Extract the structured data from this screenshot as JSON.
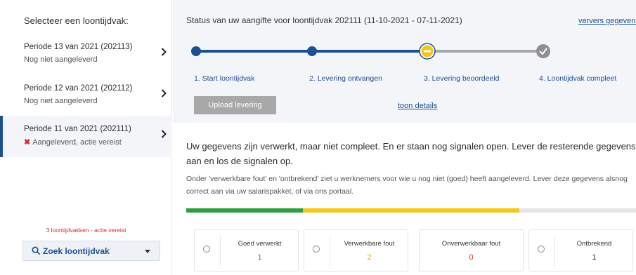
{
  "sidebar": {
    "title": "Selecteer een loontijdvak:",
    "periods": [
      {
        "title": "Periode 13 van 2021 (202113)",
        "status": "Nog niet aangeleverd"
      },
      {
        "title": "Periode 12 van 2021 (202112)",
        "status": "Nog niet aangeleverd"
      },
      {
        "title": "Periode 11 van 2021 (202111)",
        "status": "Aangeleverd, actie vereist",
        "selected": true
      }
    ],
    "warning": "3 loontijdvakken - actie vereist",
    "search_label": "Zoek loontijdvak"
  },
  "main": {
    "status_title": "Status van uw aangifte voor loontijdvak 202111 (11-10-2021 - 07-11-2021)",
    "refresh_link": "ververs gegevens",
    "steps": [
      {
        "label": "1. Start loontijdvak",
        "state": "done"
      },
      {
        "label": "2. Levering ontvangen",
        "state": "done"
      },
      {
        "label": "3. Levering beoordeeld",
        "state": "warning"
      },
      {
        "label": "4. Loontijdvak compleet",
        "state": "pending"
      }
    ],
    "upload_button": "Upload levering",
    "details_link": "toon details",
    "message": "Uw gegevens zijn verwerkt, maar niet compleet. En er staan nog signalen open. Lever de resterende gegevens aan en los de signalen op.",
    "submessage": "Onder 'verwerkbare fout' en 'ontbrekend' ziet u werknemers voor wie u nog niet (goed) heeft aangeleverd. Lever deze gegevens alsnog correct aan via uw salarispakket, of via ons portaal.",
    "progress": {
      "green": 0.26,
      "yellow": 0.48,
      "grey": 0.26
    },
    "tiles": [
      {
        "label": "Goed verwerkt",
        "value": "1",
        "color": "#2e9e3f",
        "has_radio": true
      },
      {
        "label": "Verwerkbare fout",
        "value": "2",
        "color": "#e0a800",
        "has_radio": true
      },
      {
        "label": "Onverwerkbaar fout",
        "value": "0",
        "color": "#d0312d",
        "has_radio": false
      },
      {
        "label": "Ontbrekend",
        "value": "1",
        "color": "#2b2b2b",
        "has_radio": true
      }
    ]
  },
  "colors": {
    "brand_blue": "#1d4f91",
    "green": "#2e9e3f",
    "yellow": "#f5c518",
    "red": "#d0312d",
    "grey": "#a8a8a8"
  }
}
